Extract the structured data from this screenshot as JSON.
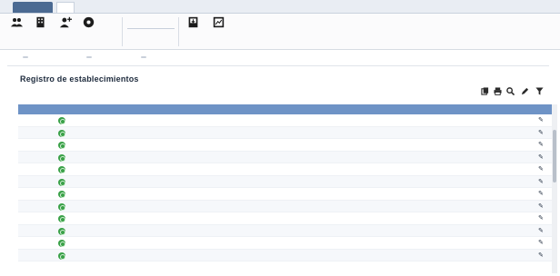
{
  "menu": {
    "tabs": [
      {
        "label": ""
      },
      {
        "label": ""
      },
      {
        "label": ""
      },
      {
        "label": ""
      },
      {
        "label": ""
      }
    ],
    "user": ""
  },
  "ribbon": {
    "buttons": [
      {
        "icon": "people-group-icon",
        "label": ""
      },
      {
        "icon": "building-icon",
        "label": ""
      },
      {
        "icon": "user-add-icon",
        "label": ""
      },
      {
        "icon": "circle-target-icon",
        "label": ""
      },
      {
        "icon": "export-document-icon",
        "label": ""
      },
      {
        "icon": "chart-report-icon",
        "label": ""
      }
    ],
    "group_labels": [
      "",
      ""
    ],
    "search_field": "",
    "search_field2": ""
  },
  "filters": [
    {
      "label": "",
      "value": ""
    },
    {
      "label": "",
      "value": ""
    },
    {
      "label": "",
      "value": ""
    }
  ],
  "panel": {
    "title": "Registro de establecimientos",
    "subtitle": ""
  },
  "toolbar_icons": [
    "copy-icon",
    "print-icon",
    "search-icon",
    "pencil-icon",
    "filter-icon"
  ],
  "table": {
    "headers": [
      "",
      "",
      "",
      "",
      "",
      "",
      "",
      "",
      ""
    ],
    "rows": [
      [
        "",
        "",
        "",
        "",
        "",
        "",
        "",
        ""
      ],
      [
        "",
        "",
        "",
        "",
        "",
        "",
        "",
        ""
      ],
      [
        "",
        "",
        "",
        "",
        "",
        "",
        "",
        ""
      ],
      [
        "",
        "",
        "",
        "",
        "",
        "",
        "",
        ""
      ],
      [
        "",
        "",
        "",
        "",
        "",
        "",
        "",
        ""
      ],
      [
        "",
        "",
        "",
        "",
        "",
        "",
        "",
        ""
      ],
      [
        "",
        "",
        "",
        "",
        "",
        "",
        "",
        ""
      ],
      [
        "",
        "",
        "",
        "",
        "",
        "",
        "",
        ""
      ],
      [
        "",
        "",
        "",
        "",
        "",
        "",
        "",
        ""
      ],
      [
        "",
        "",
        "",
        "",
        "",
        "",
        "",
        ""
      ],
      [
        "",
        "",
        "",
        "",
        "",
        "",
        "",
        ""
      ],
      [
        "",
        "",
        "",
        "",
        "",
        "",
        "",
        ""
      ]
    ]
  },
  "colors": {
    "header_bg": "#6e93c6",
    "status_green": "#3aa148",
    "link_blue": "#1f4f9a"
  }
}
